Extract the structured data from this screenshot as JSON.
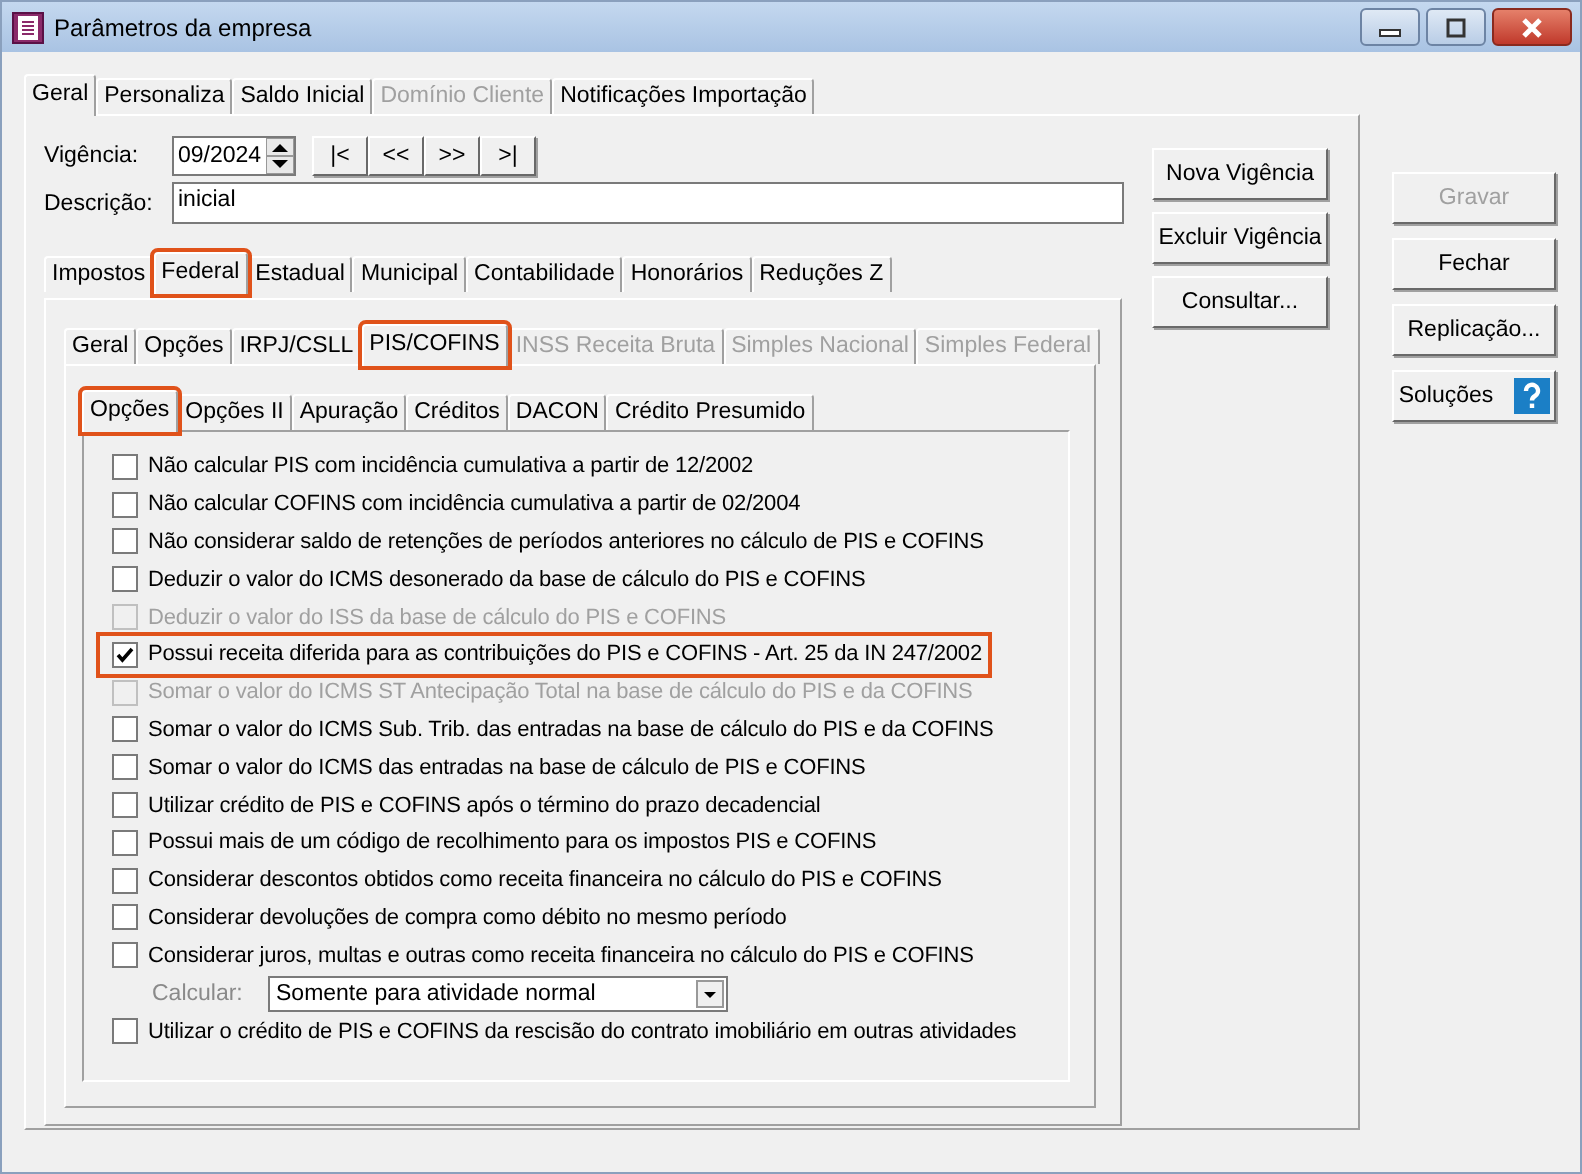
{
  "window": {
    "title": "Parâmetros da empresa"
  },
  "tabs": [
    {
      "label": "Geral",
      "selected": true,
      "disabled": false
    },
    {
      "label": "Personaliza",
      "selected": false,
      "disabled": false
    },
    {
      "label": "Saldo Inicial",
      "selected": false,
      "disabled": false
    },
    {
      "label": "Domínio Cliente",
      "selected": false,
      "disabled": true
    },
    {
      "label": "Notificações Importação",
      "selected": false,
      "disabled": false
    }
  ],
  "vigencia": {
    "label": "Vigência:",
    "value": "09/2024",
    "nav": [
      "|<",
      "<<",
      ">>",
      ">|"
    ]
  },
  "descricao": {
    "label": "Descrição:",
    "value": "inicial"
  },
  "side_buttons": [
    "Nova Vigência",
    "Excluir Vigência",
    "Consultar..."
  ],
  "tax_tabs": [
    {
      "label": "Impostos",
      "selected": false,
      "highlighted": false
    },
    {
      "label": "Federal",
      "selected": true,
      "highlighted": true
    },
    {
      "label": "Estadual",
      "selected": false,
      "highlighted": false
    },
    {
      "label": "Municipal",
      "selected": false,
      "highlighted": false
    },
    {
      "label": "Contabilidade",
      "selected": false,
      "highlighted": false
    },
    {
      "label": "Honorários",
      "selected": false,
      "highlighted": false
    },
    {
      "label": "Reduções Z",
      "selected": false,
      "highlighted": false
    }
  ],
  "federal_tabs": [
    {
      "label": "Geral",
      "selected": false,
      "disabled": false,
      "highlighted": false
    },
    {
      "label": "Opções",
      "selected": false,
      "disabled": false,
      "highlighted": false
    },
    {
      "label": "IRPJ/CSLL",
      "selected": false,
      "disabled": false,
      "highlighted": false
    },
    {
      "label": "PIS/COFINS",
      "selected": true,
      "disabled": false,
      "highlighted": true
    },
    {
      "label": "INSS Receita Bruta",
      "selected": false,
      "disabled": true,
      "highlighted": false
    },
    {
      "label": "Simples Nacional",
      "selected": false,
      "disabled": true,
      "highlighted": false
    },
    {
      "label": "Simples Federal",
      "selected": false,
      "disabled": true,
      "highlighted": false
    }
  ],
  "pis_tabs": [
    {
      "label": "Opções",
      "selected": true,
      "highlighted": true
    },
    {
      "label": "Opções II",
      "selected": false,
      "highlighted": false
    },
    {
      "label": "Apuração",
      "selected": false,
      "highlighted": false
    },
    {
      "label": "Créditos",
      "selected": false,
      "highlighted": false
    },
    {
      "label": "DACON",
      "selected": false,
      "highlighted": false
    },
    {
      "label": "Crédito Presumido",
      "selected": false,
      "highlighted": false
    }
  ],
  "options": [
    {
      "kind": "checkbox",
      "label": "Não calcular PIS com incidência cumulativa a partir de 12/2002",
      "checked": false,
      "disabled": false,
      "highlighted": false
    },
    {
      "kind": "checkbox",
      "label": "Não calcular COFINS com incidência cumulativa a partir de 02/2004",
      "checked": false,
      "disabled": false,
      "highlighted": false
    },
    {
      "kind": "checkbox",
      "label": "Não considerar saldo de retenções de períodos anteriores no cálculo de PIS e COFINS",
      "checked": false,
      "disabled": false,
      "highlighted": false
    },
    {
      "kind": "checkbox",
      "label": "Deduzir o valor do ICMS desonerado da base de cálculo do PIS e COFINS",
      "checked": false,
      "disabled": false,
      "highlighted": false
    },
    {
      "kind": "checkbox",
      "label": "Deduzir o valor do ISS da base de cálculo do PIS e COFINS",
      "checked": false,
      "disabled": true,
      "highlighted": false
    },
    {
      "kind": "checkbox",
      "label": "Possui receita diferida para as contribuições do PIS e COFINS - Art. 25 da IN 247/2002",
      "checked": true,
      "disabled": false,
      "highlighted": true
    },
    {
      "kind": "checkbox",
      "label": "Somar o valor do ICMS ST Antecipação Total na base de cálculo do PIS e da COFINS",
      "checked": false,
      "disabled": true,
      "highlighted": false
    },
    {
      "kind": "checkbox",
      "label": "Somar o valor do ICMS Sub. Trib. das entradas na base de cálculo do PIS e da COFINS",
      "checked": false,
      "disabled": false,
      "highlighted": false
    },
    {
      "kind": "checkbox",
      "label": "Somar o valor do ICMS das entradas na base de cálculo de PIS e COFINS",
      "checked": false,
      "disabled": false,
      "highlighted": false
    },
    {
      "kind": "checkbox",
      "label": "Utilizar crédito de PIS e COFINS após o término do prazo decadencial",
      "checked": false,
      "disabled": false,
      "highlighted": false
    },
    {
      "kind": "checkbox",
      "label": "Possui mais de um código de recolhimento para os impostos PIS e COFINS",
      "checked": false,
      "disabled": false,
      "highlighted": false
    },
    {
      "kind": "checkbox",
      "label": "Considerar descontos obtidos como receita financeira no cálculo do PIS e COFINS",
      "checked": false,
      "disabled": false,
      "highlighted": false
    },
    {
      "kind": "checkbox",
      "label": "Considerar devoluções de compra como débito no mesmo período",
      "checked": false,
      "disabled": false,
      "highlighted": false
    },
    {
      "kind": "checkbox",
      "label": "Considerar juros, multas e outras como receita financeira no cálculo do PIS e COFINS",
      "checked": false,
      "disabled": false,
      "highlighted": false
    },
    {
      "kind": "select",
      "label": "Calcular:",
      "value": "Somente para atividade normal",
      "disabled": true
    },
    {
      "kind": "checkbox",
      "label": "Utilizar o crédito de PIS e COFINS da rescisão do contrato imobiliário em outras atividades",
      "checked": false,
      "disabled": false,
      "highlighted": false
    }
  ],
  "actions": [
    {
      "label": "Gravar",
      "disabled": true,
      "help": false
    },
    {
      "label": "Fechar",
      "disabled": false,
      "help": false
    },
    {
      "label": "Replicação...",
      "disabled": false,
      "help": false
    },
    {
      "label": "Soluções",
      "disabled": false,
      "help": true
    }
  ]
}
